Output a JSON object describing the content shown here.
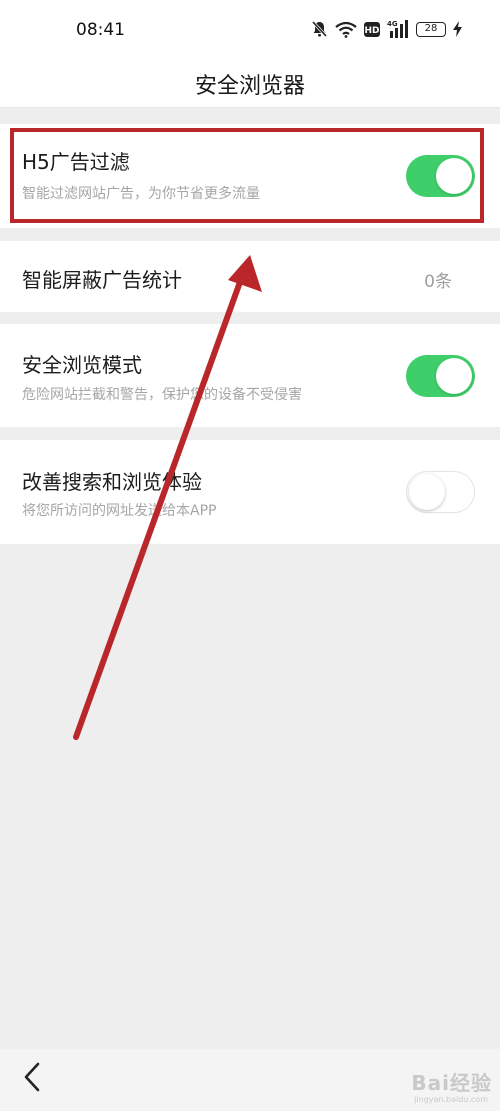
{
  "status_bar": {
    "time": "08:41",
    "network_label": "4G",
    "hd_label": "HD",
    "battery_level": "28",
    "icons": [
      "mute-bell-icon",
      "wifi-icon",
      "hd-icon",
      "signal-4g-icon",
      "battery-icon",
      "charging-bolt-icon"
    ]
  },
  "header": {
    "title": "安全浏览器"
  },
  "settings": [
    {
      "title": "H5广告过滤",
      "subtitle": "智能过滤网站广告，为你节省更多流量",
      "toggle": true
    },
    {
      "title": "智能屏蔽广告统计",
      "value": "0条"
    },
    {
      "title": "安全浏览模式",
      "subtitle": "危险网站拦截和警告，保护您的设备不受侵害",
      "toggle": true
    },
    {
      "title": "改善搜索和浏览体验",
      "subtitle": "将您所访问的网址发送给本APP",
      "toggle": false
    }
  ],
  "bottom_nav": {
    "back_icon": "chevron-left-icon"
  },
  "watermark": {
    "text": "Bai经验",
    "sub": "jingyan.baidu.com"
  },
  "colors": {
    "toggle_on": "#3fcf6a",
    "highlight": "#b9272a",
    "arrow": "#b9272a",
    "background": "#eeeeee"
  }
}
